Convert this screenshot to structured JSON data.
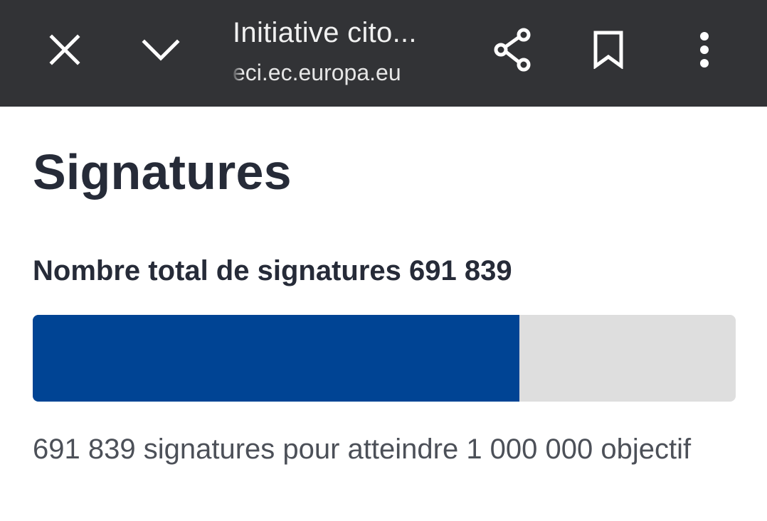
{
  "toolbar": {
    "page_title": "Initiative cito...",
    "url": "eci.ec.europa.eu",
    "icons": {
      "close": "close-icon",
      "collapse": "chevron-down-icon",
      "share": "share-icon",
      "bookmark": "bookmark-icon",
      "more": "more-vertical-icon"
    },
    "background_color": "#323336"
  },
  "main": {
    "heading": "Signatures",
    "total_label": "Nombre total de signatures",
    "total_value": "691 839",
    "progress": {
      "current": 691839,
      "goal": 1000000,
      "fill_color": "#004494",
      "track_color": "#dedede"
    },
    "caption": "691 839 signatures pour atteindre 1 000 000 objectif"
  }
}
